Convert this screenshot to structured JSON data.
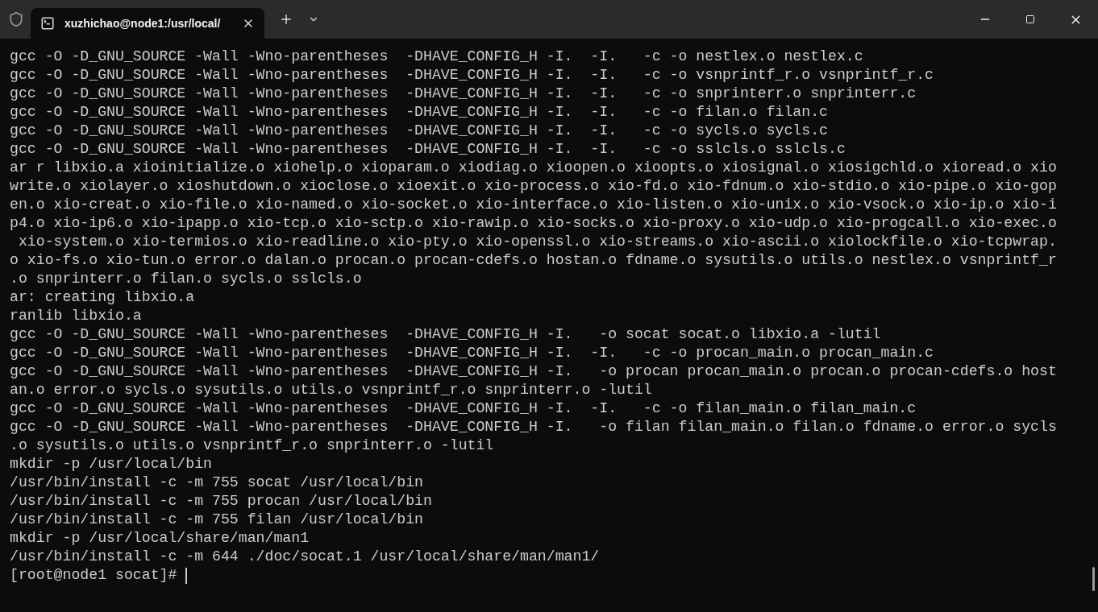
{
  "tab": {
    "title": "xuzhichao@node1:/usr/local/",
    "selected": true
  },
  "terminal": {
    "lines": [
      "gcc -O -D_GNU_SOURCE -Wall -Wno-parentheses  -DHAVE_CONFIG_H -I.  -I.   -c -o nestlex.o nestlex.c",
      "gcc -O -D_GNU_SOURCE -Wall -Wno-parentheses  -DHAVE_CONFIG_H -I.  -I.   -c -o vsnprintf_r.o vsnprintf_r.c",
      "gcc -O -D_GNU_SOURCE -Wall -Wno-parentheses  -DHAVE_CONFIG_H -I.  -I.   -c -o snprinterr.o snprinterr.c",
      "gcc -O -D_GNU_SOURCE -Wall -Wno-parentheses  -DHAVE_CONFIG_H -I.  -I.   -c -o filan.o filan.c",
      "gcc -O -D_GNU_SOURCE -Wall -Wno-parentheses  -DHAVE_CONFIG_H -I.  -I.   -c -o sycls.o sycls.c",
      "gcc -O -D_GNU_SOURCE -Wall -Wno-parentheses  -DHAVE_CONFIG_H -I.  -I.   -c -o sslcls.o sslcls.c",
      "ar r libxio.a xioinitialize.o xiohelp.o xioparam.o xiodiag.o xioopen.o xioopts.o xiosignal.o xiosigchld.o xioread.o xio",
      "write.o xiolayer.o xioshutdown.o xioclose.o xioexit.o xio-process.o xio-fd.o xio-fdnum.o xio-stdio.o xio-pipe.o xio-gop",
      "en.o xio-creat.o xio-file.o xio-named.o xio-socket.o xio-interface.o xio-listen.o xio-unix.o xio-vsock.o xio-ip.o xio-i",
      "p4.o xio-ip6.o xio-ipapp.o xio-tcp.o xio-sctp.o xio-rawip.o xio-socks.o xio-proxy.o xio-udp.o xio-progcall.o xio-exec.o",
      " xio-system.o xio-termios.o xio-readline.o xio-pty.o xio-openssl.o xio-streams.o xio-ascii.o xiolockfile.o xio-tcpwrap.",
      "o xio-fs.o xio-tun.o error.o dalan.o procan.o procan-cdefs.o hostan.o fdname.o sysutils.o utils.o nestlex.o vsnprintf_r",
      ".o snprinterr.o filan.o sycls.o sslcls.o",
      "ar: creating libxio.a",
      "ranlib libxio.a",
      "gcc -O -D_GNU_SOURCE -Wall -Wno-parentheses  -DHAVE_CONFIG_H -I.   -o socat socat.o libxio.a -lutil",
      "gcc -O -D_GNU_SOURCE -Wall -Wno-parentheses  -DHAVE_CONFIG_H -I.  -I.   -c -o procan_main.o procan_main.c",
      "gcc -O -D_GNU_SOURCE -Wall -Wno-parentheses  -DHAVE_CONFIG_H -I.   -o procan procan_main.o procan.o procan-cdefs.o host",
      "an.o error.o sycls.o sysutils.o utils.o vsnprintf_r.o snprinterr.o -lutil",
      "gcc -O -D_GNU_SOURCE -Wall -Wno-parentheses  -DHAVE_CONFIG_H -I.  -I.   -c -o filan_main.o filan_main.c",
      "gcc -O -D_GNU_SOURCE -Wall -Wno-parentheses  -DHAVE_CONFIG_H -I.   -o filan filan_main.o filan.o fdname.o error.o sycls",
      ".o sysutils.o utils.o vsnprintf_r.o snprinterr.o -lutil",
      "mkdir -p /usr/local/bin",
      "/usr/bin/install -c -m 755 socat /usr/local/bin",
      "/usr/bin/install -c -m 755 procan /usr/local/bin",
      "/usr/bin/install -c -m 755 filan /usr/local/bin",
      "mkdir -p /usr/local/share/man/man1",
      "/usr/bin/install -c -m 644 ./doc/socat.1 /usr/local/share/man/man1/"
    ],
    "prompt": "[root@node1 socat]# "
  }
}
